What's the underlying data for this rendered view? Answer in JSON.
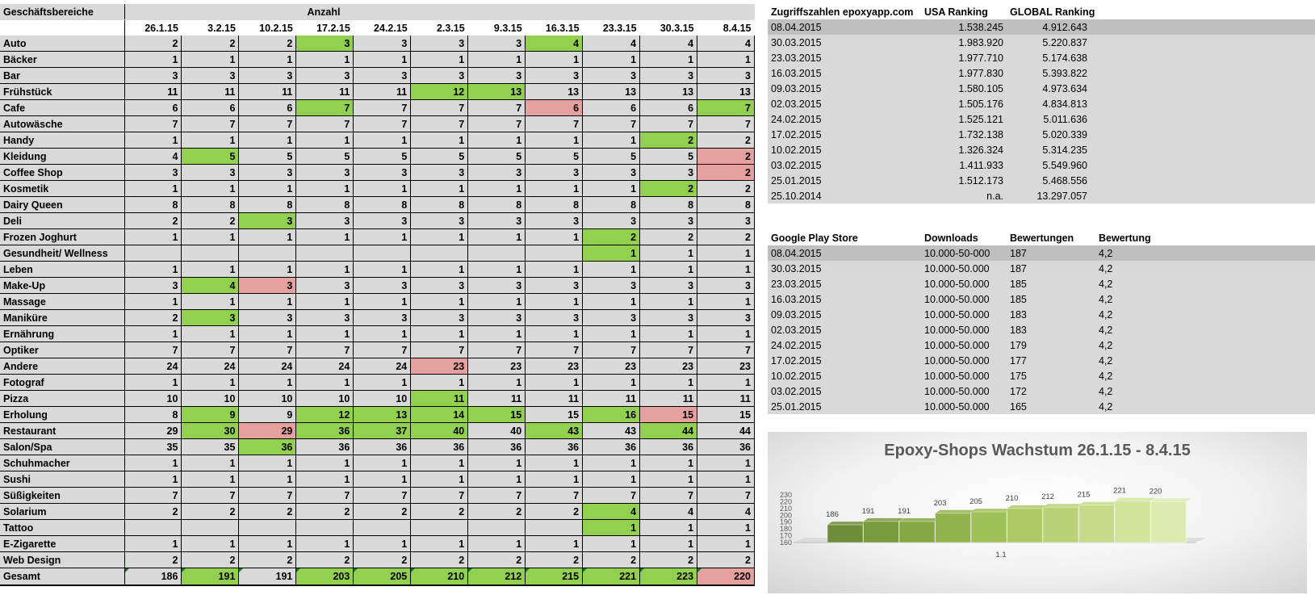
{
  "left_table": {
    "header_label": "Geschäftsbereiche",
    "group_label": "Anzahl",
    "dates": [
      "26.1.15",
      "3.2.15",
      "10.2.15",
      "17.2.15",
      "24.2.15",
      "2.3.15",
      "9.3.15",
      "16.3.15",
      "23.3.15",
      "30.3.15",
      "8.4.15"
    ],
    "rows": [
      {
        "name": "Auto",
        "values": [
          "2",
          "2",
          "2",
          "3",
          "3",
          "3",
          "3",
          "4",
          "4",
          "4",
          "4"
        ],
        "hl": [
          "",
          "",
          "",
          "g",
          "",
          "",
          "",
          "g",
          "",
          "",
          ""
        ]
      },
      {
        "name": "Bäcker",
        "values": [
          "1",
          "1",
          "1",
          "1",
          "1",
          "1",
          "1",
          "1",
          "1",
          "1",
          "1"
        ],
        "hl": [
          "",
          "",
          "",
          "",
          "",
          "",
          "",
          "",
          "",
          "",
          ""
        ]
      },
      {
        "name": "Bar",
        "values": [
          "3",
          "3",
          "3",
          "3",
          "3",
          "3",
          "3",
          "3",
          "3",
          "3",
          "3"
        ],
        "hl": [
          "",
          "",
          "",
          "",
          "",
          "",
          "",
          "",
          "",
          "",
          ""
        ]
      },
      {
        "name": "Frühstück",
        "values": [
          "11",
          "11",
          "11",
          "11",
          "11",
          "12",
          "13",
          "13",
          "13",
          "13",
          "13"
        ],
        "hl": [
          "",
          "",
          "",
          "",
          "",
          "g",
          "g",
          "",
          "",
          "",
          ""
        ]
      },
      {
        "name": "Cafe",
        "values": [
          "6",
          "6",
          "6",
          "7",
          "7",
          "7",
          "7",
          "6",
          "6",
          "6",
          "7"
        ],
        "hl": [
          "",
          "",
          "",
          "g",
          "",
          "",
          "",
          "r",
          "",
          "",
          "g"
        ]
      },
      {
        "name": "Autowäsche",
        "values": [
          "7",
          "7",
          "7",
          "7",
          "7",
          "7",
          "7",
          "7",
          "7",
          "7",
          "7"
        ],
        "hl": [
          "",
          "",
          "",
          "",
          "",
          "",
          "",
          "",
          "",
          "",
          ""
        ]
      },
      {
        "name": "Handy",
        "values": [
          "1",
          "1",
          "1",
          "1",
          "1",
          "1",
          "1",
          "1",
          "1",
          "2",
          "2"
        ],
        "hl": [
          "",
          "",
          "",
          "",
          "",
          "",
          "",
          "",
          "",
          "g",
          ""
        ]
      },
      {
        "name": "Kleidung",
        "values": [
          "4",
          "5",
          "5",
          "5",
          "5",
          "5",
          "5",
          "5",
          "5",
          "5",
          "2"
        ],
        "hl": [
          "",
          "g",
          "",
          "",
          "",
          "",
          "",
          "",
          "",
          "",
          "r"
        ]
      },
      {
        "name": "Coffee Shop",
        "values": [
          "3",
          "3",
          "3",
          "3",
          "3",
          "3",
          "3",
          "3",
          "3",
          "3",
          "2"
        ],
        "hl": [
          "",
          "",
          "",
          "",
          "",
          "",
          "",
          "",
          "",
          "",
          "r"
        ]
      },
      {
        "name": "Kosmetik",
        "values": [
          "1",
          "1",
          "1",
          "1",
          "1",
          "1",
          "1",
          "1",
          "1",
          "2",
          "2"
        ],
        "hl": [
          "",
          "",
          "",
          "",
          "",
          "",
          "",
          "",
          "",
          "g",
          ""
        ]
      },
      {
        "name": "Dairy Queen",
        "values": [
          "8",
          "8",
          "8",
          "8",
          "8",
          "8",
          "8",
          "8",
          "8",
          "8",
          "8"
        ],
        "hl": [
          "",
          "",
          "",
          "",
          "",
          "",
          "",
          "",
          "",
          "",
          ""
        ]
      },
      {
        "name": "Deli",
        "values": [
          "2",
          "2",
          "3",
          "3",
          "3",
          "3",
          "3",
          "3",
          "3",
          "3",
          "3"
        ],
        "hl": [
          "",
          "",
          "g",
          "",
          "",
          "",
          "",
          "",
          "",
          "",
          ""
        ]
      },
      {
        "name": "Frozen Joghurt",
        "values": [
          "1",
          "1",
          "1",
          "1",
          "1",
          "1",
          "1",
          "1",
          "2",
          "2",
          "2"
        ],
        "hl": [
          "",
          "",
          "",
          "",
          "",
          "",
          "",
          "",
          "g",
          "",
          ""
        ]
      },
      {
        "name": "Gesundheit/ Wellness",
        "values": [
          "",
          "",
          "",
          "",
          "",
          "",
          "",
          "",
          "1",
          "1",
          "1"
        ],
        "hl": [
          "",
          "",
          "",
          "",
          "",
          "",
          "",
          "",
          "g",
          "",
          ""
        ]
      },
      {
        "name": "Leben",
        "values": [
          "1",
          "1",
          "1",
          "1",
          "1",
          "1",
          "1",
          "1",
          "1",
          "1",
          "1"
        ],
        "hl": [
          "",
          "",
          "",
          "",
          "",
          "",
          "",
          "",
          "",
          "",
          ""
        ]
      },
      {
        "name": "Make-Up",
        "values": [
          "3",
          "4",
          "3",
          "3",
          "3",
          "3",
          "3",
          "3",
          "3",
          "3",
          "3"
        ],
        "hl": [
          "",
          "g",
          "r",
          "",
          "",
          "",
          "",
          "",
          "",
          "",
          ""
        ]
      },
      {
        "name": "Massage",
        "values": [
          "1",
          "1",
          "1",
          "1",
          "1",
          "1",
          "1",
          "1",
          "1",
          "1",
          "1"
        ],
        "hl": [
          "",
          "",
          "",
          "",
          "",
          "",
          "",
          "",
          "",
          "",
          ""
        ]
      },
      {
        "name": "Maniküre",
        "values": [
          "2",
          "3",
          "3",
          "3",
          "3",
          "3",
          "3",
          "3",
          "3",
          "3",
          "3"
        ],
        "hl": [
          "",
          "g",
          "",
          "",
          "",
          "",
          "",
          "",
          "",
          "",
          ""
        ]
      },
      {
        "name": "Ernährung",
        "values": [
          "1",
          "1",
          "1",
          "1",
          "1",
          "1",
          "1",
          "1",
          "1",
          "1",
          "1"
        ],
        "hl": [
          "",
          "",
          "",
          "",
          "",
          "",
          "",
          "",
          "",
          "",
          ""
        ]
      },
      {
        "name": "Optiker",
        "values": [
          "7",
          "7",
          "7",
          "7",
          "7",
          "7",
          "7",
          "7",
          "7",
          "7",
          "7"
        ],
        "hl": [
          "",
          "",
          "",
          "",
          "",
          "",
          "",
          "",
          "",
          "",
          ""
        ]
      },
      {
        "name": "Andere",
        "values": [
          "24",
          "24",
          "24",
          "24",
          "24",
          "23",
          "23",
          "23",
          "23",
          "23",
          "23"
        ],
        "hl": [
          "",
          "",
          "",
          "",
          "",
          "r",
          "",
          "",
          "",
          "",
          ""
        ]
      },
      {
        "name": "Fotograf",
        "values": [
          "1",
          "1",
          "1",
          "1",
          "1",
          "1",
          "1",
          "1",
          "1",
          "1",
          "1"
        ],
        "hl": [
          "",
          "",
          "",
          "",
          "",
          "",
          "",
          "",
          "",
          "",
          ""
        ]
      },
      {
        "name": "Pizza",
        "values": [
          "10",
          "10",
          "10",
          "10",
          "10",
          "11",
          "11",
          "11",
          "11",
          "11",
          "11"
        ],
        "hl": [
          "",
          "",
          "",
          "",
          "",
          "g",
          "",
          "",
          "",
          "",
          ""
        ]
      },
      {
        "name": "Erholung",
        "values": [
          "8",
          "9",
          "9",
          "12",
          "13",
          "14",
          "15",
          "15",
          "16",
          "15",
          "15"
        ],
        "hl": [
          "",
          "g",
          "",
          "g",
          "g",
          "g",
          "g",
          "",
          "g",
          "r",
          ""
        ]
      },
      {
        "name": "Restaurant",
        "values": [
          "29",
          "30",
          "29",
          "36",
          "37",
          "40",
          "40",
          "43",
          "43",
          "44",
          "44"
        ],
        "hl": [
          "",
          "g",
          "r",
          "g",
          "g",
          "g",
          "",
          "g",
          "",
          "g",
          ""
        ]
      },
      {
        "name": "Salon/Spa",
        "values": [
          "35",
          "35",
          "36",
          "36",
          "36",
          "36",
          "36",
          "36",
          "36",
          "36",
          "36"
        ],
        "hl": [
          "",
          "",
          "g",
          "",
          "",
          "",
          "",
          "",
          "",
          "",
          ""
        ]
      },
      {
        "name": "Schuhmacher",
        "values": [
          "1",
          "1",
          "1",
          "1",
          "1",
          "1",
          "1",
          "1",
          "1",
          "1",
          "1"
        ],
        "hl": [
          "",
          "",
          "",
          "",
          "",
          "",
          "",
          "",
          "",
          "",
          ""
        ]
      },
      {
        "name": "Sushi",
        "values": [
          "1",
          "1",
          "1",
          "1",
          "1",
          "1",
          "1",
          "1",
          "1",
          "1",
          "1"
        ],
        "hl": [
          "",
          "",
          "",
          "",
          "",
          "",
          "",
          "",
          "",
          "",
          ""
        ]
      },
      {
        "name": "Süßigkeiten",
        "values": [
          "7",
          "7",
          "7",
          "7",
          "7",
          "7",
          "7",
          "7",
          "7",
          "7",
          "7"
        ],
        "hl": [
          "",
          "",
          "",
          "",
          "",
          "",
          "",
          "",
          "",
          "",
          ""
        ]
      },
      {
        "name": "Solarium",
        "values": [
          "2",
          "2",
          "2",
          "2",
          "2",
          "2",
          "2",
          "2",
          "4",
          "4",
          "4"
        ],
        "hl": [
          "",
          "",
          "",
          "",
          "",
          "",
          "",
          "",
          "g",
          "",
          ""
        ]
      },
      {
        "name": "Tattoo",
        "values": [
          "",
          "",
          "",
          "",
          "",
          "",
          "",
          "",
          "1",
          "1",
          "1"
        ],
        "hl": [
          "",
          "",
          "",
          "",
          "",
          "",
          "",
          "",
          "g",
          "",
          ""
        ]
      },
      {
        "name": "E-Zigarette",
        "values": [
          "1",
          "1",
          "1",
          "1",
          "1",
          "1",
          "1",
          "1",
          "1",
          "1",
          "1"
        ],
        "hl": [
          "",
          "",
          "",
          "",
          "",
          "",
          "",
          "",
          "",
          "",
          ""
        ]
      },
      {
        "name": "Web Design",
        "values": [
          "2",
          "2",
          "2",
          "2",
          "2",
          "2",
          "2",
          "2",
          "2",
          "2",
          "2"
        ],
        "hl": [
          "",
          "",
          "",
          "",
          "",
          "",
          "",
          "",
          "",
          "",
          ""
        ]
      }
    ],
    "total": {
      "name": "Gesamt",
      "values": [
        "186",
        "191",
        "191",
        "203",
        "205",
        "210",
        "212",
        "215",
        "221",
        "223",
        "220"
      ],
      "hl": [
        "",
        "g",
        "",
        "g",
        "g",
        "g",
        "g",
        "g",
        "g",
        "g",
        "r"
      ]
    }
  },
  "access_table": {
    "headers": [
      "Zugriffszahlen epoxyapp.com",
      "USA Ranking",
      "GLOBAL Ranking"
    ],
    "rows": [
      [
        "08.04.2015",
        "1.538.245",
        "4.912.643"
      ],
      [
        "30.03.2015",
        "1.983.920",
        "5.220.837"
      ],
      [
        "23.03.2015",
        "1.977.710",
        "5.174.638"
      ],
      [
        "16.03.2015",
        "1.977.830",
        "5.393.822"
      ],
      [
        "09.03.2015",
        "1.580.105",
        "4.973.634"
      ],
      [
        "02.03.2015",
        "1.505.176",
        "4.834.813"
      ],
      [
        "24.02.2015",
        "1.525.121",
        "5.011.636"
      ],
      [
        "17.02.2015",
        "1.732.138",
        "5.020.339"
      ],
      [
        "10.02.2015",
        "1.326.324",
        "5.314.235"
      ],
      [
        "03.02.2015",
        "1.411.933",
        "5.549.960"
      ],
      [
        "25.01.2015",
        "1.512.173",
        "5.468.556"
      ],
      [
        "25.10.2014",
        "n.a.",
        "13.297.057"
      ]
    ]
  },
  "play_table": {
    "headers": [
      "Google Play Store",
      "Downloads",
      "Bewertungen",
      "Bewertung"
    ],
    "rows": [
      [
        "08.04.2015",
        "10.000-50-000",
        "187",
        "4,2"
      ],
      [
        "30.03.2015",
        "10.000-50.000",
        "187",
        "4,2"
      ],
      [
        "23.03.2015",
        "10.000-50.000",
        "185",
        "4,2"
      ],
      [
        "16.03.2015",
        "10.000-50.000",
        "185",
        "4,2"
      ],
      [
        "09.03.2015",
        "10.000-50.000",
        "183",
        "4,2"
      ],
      [
        "02.03.2015",
        "10.000-50.000",
        "183",
        "4,2"
      ],
      [
        "24.02.2015",
        "10.000-50.000",
        "179",
        "4,2"
      ],
      [
        "17.02.2015",
        "10.000-50.000",
        "177",
        "4,2"
      ],
      [
        "10.02.2015",
        "10.000-50.000",
        "175",
        "4,2"
      ],
      [
        "03.02.2015",
        "10.000-50.000",
        "172",
        "4,2"
      ],
      [
        "25.01.2015",
        "10.000-50.000",
        "165",
        "4,2"
      ]
    ]
  },
  "chart_data": {
    "type": "bar",
    "title": "Epoxy-Shops Wachstum 26.1.15 - 8.4.15",
    "categories": [
      "1.1"
    ],
    "values": [
      186,
      191,
      191,
      203,
      205,
      210,
      212,
      215,
      221,
      220
    ],
    "ylim": [
      160,
      230
    ],
    "yticks": [
      "160",
      "170",
      "180",
      "190",
      "200",
      "210",
      "220",
      "230"
    ],
    "legend": "none",
    "grid": false,
    "colors": [
      "#6e8c3a",
      "#7a9a3e",
      "#86a744",
      "#93b44d",
      "#a0c058",
      "#adc966",
      "#b9d277",
      "#c5db89",
      "#d2e49c",
      "#deebb0"
    ]
  }
}
